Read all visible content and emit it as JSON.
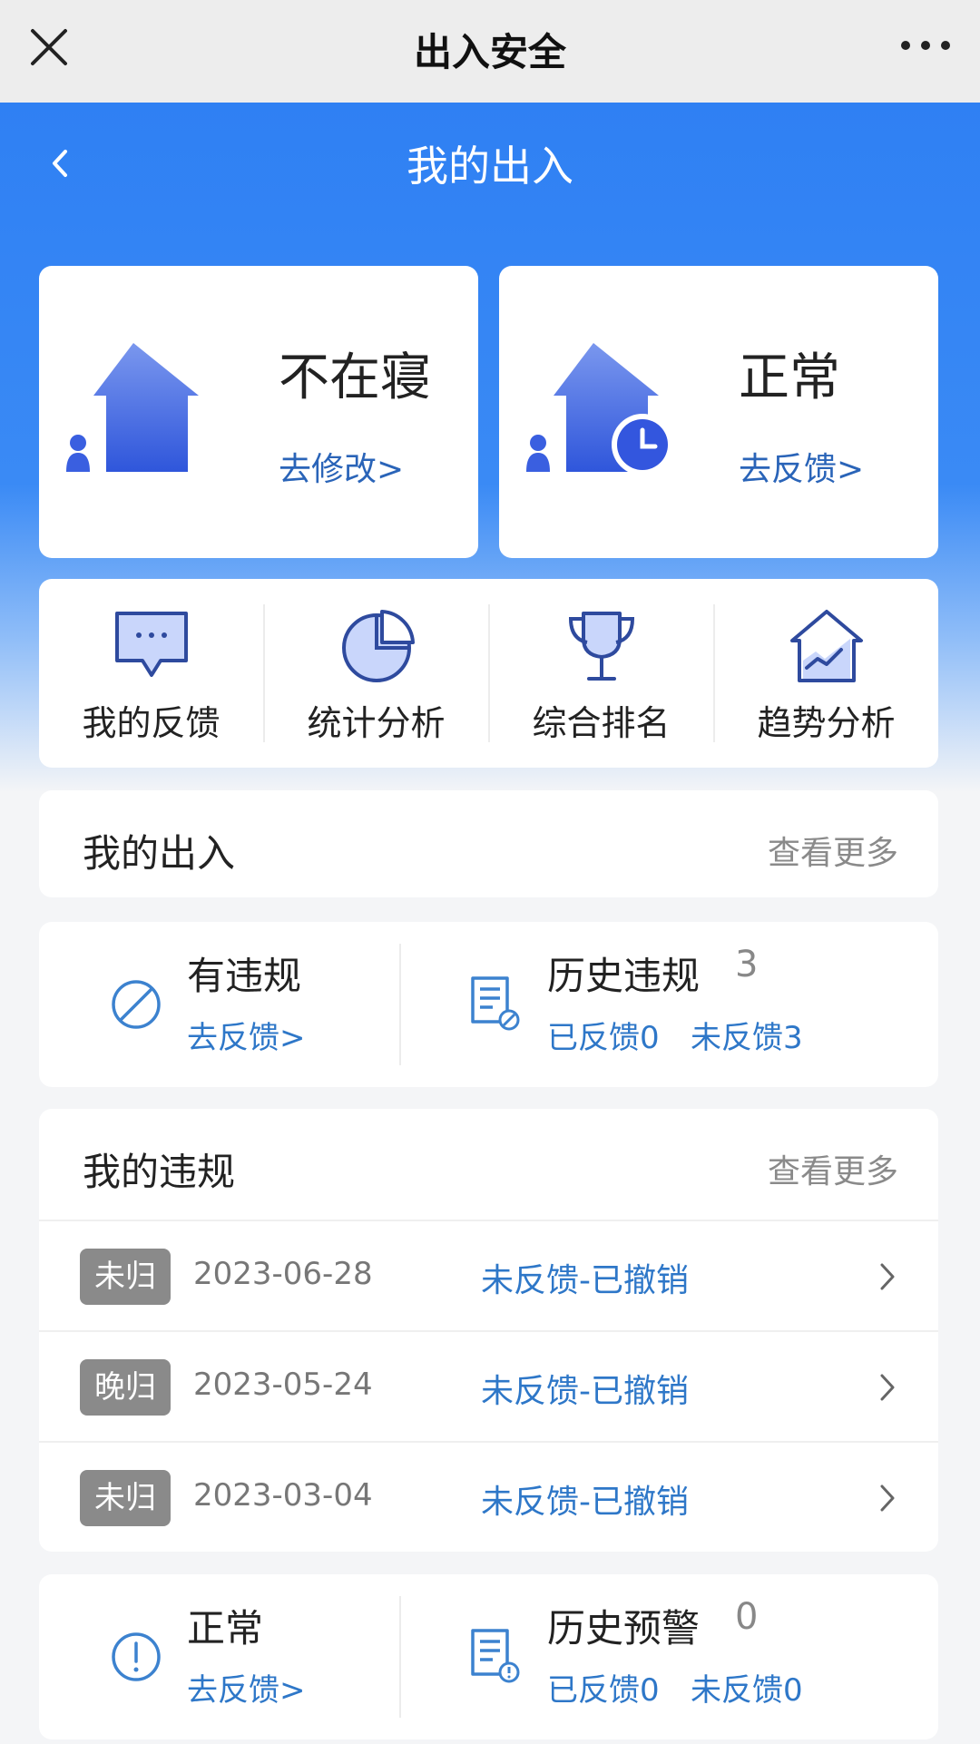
{
  "window": {
    "title": "出入安全"
  },
  "header": {
    "title": "我的出入"
  },
  "status_cards": [
    {
      "status": "不在寝",
      "link": "去修改>"
    },
    {
      "status": "正常",
      "link": "去反馈>"
    }
  ],
  "menu": [
    {
      "label": "我的反馈",
      "icon": "message-icon"
    },
    {
      "label": "统计分析",
      "icon": "pie-chart-icon"
    },
    {
      "label": "综合排名",
      "icon": "trophy-icon"
    },
    {
      "label": "趋势分析",
      "icon": "trend-house-icon"
    }
  ],
  "my_access": {
    "title": "我的出入",
    "more": "查看更多"
  },
  "violations_summary": {
    "current": {
      "title": "有违规",
      "link": "去反馈>"
    },
    "history": {
      "title": "历史违规",
      "count": "3",
      "done": "已反馈0",
      "pending": "未反馈3"
    }
  },
  "my_violations": {
    "title": "我的违规",
    "more": "查看更多",
    "rows": [
      {
        "tag": "未归",
        "date": "2023-06-28",
        "status": "未反馈-已撤销"
      },
      {
        "tag": "晚归",
        "date": "2023-05-24",
        "status": "未反馈-已撤销"
      },
      {
        "tag": "未归",
        "date": "2023-03-04",
        "status": "未反馈-已撤销"
      }
    ]
  },
  "warnings_summary": {
    "current": {
      "title": "正常",
      "link": "去反馈>"
    },
    "history": {
      "title": "历史预警",
      "count": "0",
      "done": "已反馈0",
      "pending": "未反馈0"
    }
  },
  "colors": {
    "primary": "#2f80f3",
    "link": "#2e77c8",
    "tag": "#8a8a8a"
  }
}
